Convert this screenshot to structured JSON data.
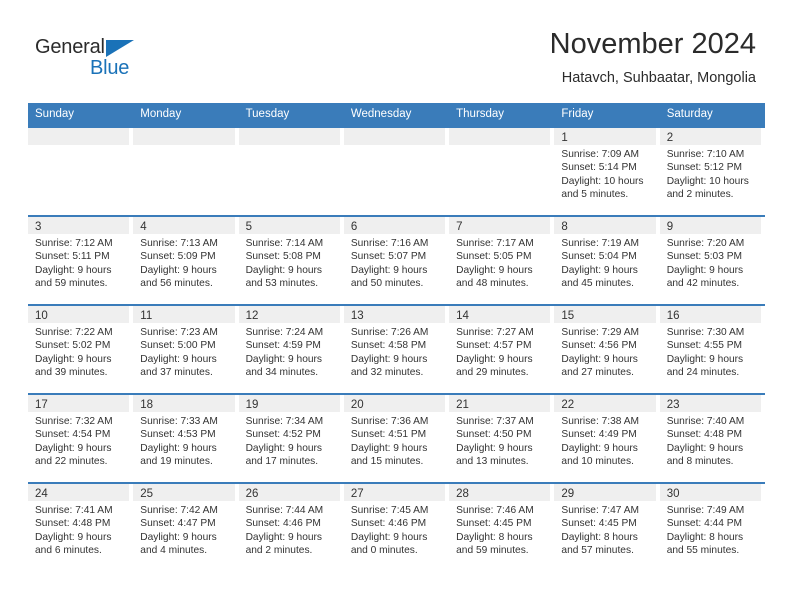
{
  "brand": {
    "name_part1": "General",
    "name_part2": "Blue",
    "flag_icon": "blue-triangle-flag",
    "accent_color": "#1a72b8"
  },
  "header": {
    "title": "November 2024",
    "subtitle": "Hatavch, Suhbaatar, Mongolia"
  },
  "theme": {
    "header_blue": "#3a7cba",
    "band_gray": "#efefef",
    "text": "#333333"
  },
  "weekdays": [
    "Sunday",
    "Monday",
    "Tuesday",
    "Wednesday",
    "Thursday",
    "Friday",
    "Saturday"
  ],
  "weeks": [
    [
      {
        "day": "",
        "lines": []
      },
      {
        "day": "",
        "lines": []
      },
      {
        "day": "",
        "lines": []
      },
      {
        "day": "",
        "lines": []
      },
      {
        "day": "",
        "lines": []
      },
      {
        "day": "1",
        "lines": [
          "Sunrise: 7:09 AM",
          "Sunset: 5:14 PM",
          "Daylight: 10 hours",
          "and 5 minutes."
        ]
      },
      {
        "day": "2",
        "lines": [
          "Sunrise: 7:10 AM",
          "Sunset: 5:12 PM",
          "Daylight: 10 hours",
          "and 2 minutes."
        ]
      }
    ],
    [
      {
        "day": "3",
        "lines": [
          "Sunrise: 7:12 AM",
          "Sunset: 5:11 PM",
          "Daylight: 9 hours",
          "and 59 minutes."
        ]
      },
      {
        "day": "4",
        "lines": [
          "Sunrise: 7:13 AM",
          "Sunset: 5:09 PM",
          "Daylight: 9 hours",
          "and 56 minutes."
        ]
      },
      {
        "day": "5",
        "lines": [
          "Sunrise: 7:14 AM",
          "Sunset: 5:08 PM",
          "Daylight: 9 hours",
          "and 53 minutes."
        ]
      },
      {
        "day": "6",
        "lines": [
          "Sunrise: 7:16 AM",
          "Sunset: 5:07 PM",
          "Daylight: 9 hours",
          "and 50 minutes."
        ]
      },
      {
        "day": "7",
        "lines": [
          "Sunrise: 7:17 AM",
          "Sunset: 5:05 PM",
          "Daylight: 9 hours",
          "and 48 minutes."
        ]
      },
      {
        "day": "8",
        "lines": [
          "Sunrise: 7:19 AM",
          "Sunset: 5:04 PM",
          "Daylight: 9 hours",
          "and 45 minutes."
        ]
      },
      {
        "day": "9",
        "lines": [
          "Sunrise: 7:20 AM",
          "Sunset: 5:03 PM",
          "Daylight: 9 hours",
          "and 42 minutes."
        ]
      }
    ],
    [
      {
        "day": "10",
        "lines": [
          "Sunrise: 7:22 AM",
          "Sunset: 5:02 PM",
          "Daylight: 9 hours",
          "and 39 minutes."
        ]
      },
      {
        "day": "11",
        "lines": [
          "Sunrise: 7:23 AM",
          "Sunset: 5:00 PM",
          "Daylight: 9 hours",
          "and 37 minutes."
        ]
      },
      {
        "day": "12",
        "lines": [
          "Sunrise: 7:24 AM",
          "Sunset: 4:59 PM",
          "Daylight: 9 hours",
          "and 34 minutes."
        ]
      },
      {
        "day": "13",
        "lines": [
          "Sunrise: 7:26 AM",
          "Sunset: 4:58 PM",
          "Daylight: 9 hours",
          "and 32 minutes."
        ]
      },
      {
        "day": "14",
        "lines": [
          "Sunrise: 7:27 AM",
          "Sunset: 4:57 PM",
          "Daylight: 9 hours",
          "and 29 minutes."
        ]
      },
      {
        "day": "15",
        "lines": [
          "Sunrise: 7:29 AM",
          "Sunset: 4:56 PM",
          "Daylight: 9 hours",
          "and 27 minutes."
        ]
      },
      {
        "day": "16",
        "lines": [
          "Sunrise: 7:30 AM",
          "Sunset: 4:55 PM",
          "Daylight: 9 hours",
          "and 24 minutes."
        ]
      }
    ],
    [
      {
        "day": "17",
        "lines": [
          "Sunrise: 7:32 AM",
          "Sunset: 4:54 PM",
          "Daylight: 9 hours",
          "and 22 minutes."
        ]
      },
      {
        "day": "18",
        "lines": [
          "Sunrise: 7:33 AM",
          "Sunset: 4:53 PM",
          "Daylight: 9 hours",
          "and 19 minutes."
        ]
      },
      {
        "day": "19",
        "lines": [
          "Sunrise: 7:34 AM",
          "Sunset: 4:52 PM",
          "Daylight: 9 hours",
          "and 17 minutes."
        ]
      },
      {
        "day": "20",
        "lines": [
          "Sunrise: 7:36 AM",
          "Sunset: 4:51 PM",
          "Daylight: 9 hours",
          "and 15 minutes."
        ]
      },
      {
        "day": "21",
        "lines": [
          "Sunrise: 7:37 AM",
          "Sunset: 4:50 PM",
          "Daylight: 9 hours",
          "and 13 minutes."
        ]
      },
      {
        "day": "22",
        "lines": [
          "Sunrise: 7:38 AM",
          "Sunset: 4:49 PM",
          "Daylight: 9 hours",
          "and 10 minutes."
        ]
      },
      {
        "day": "23",
        "lines": [
          "Sunrise: 7:40 AM",
          "Sunset: 4:48 PM",
          "Daylight: 9 hours",
          "and 8 minutes."
        ]
      }
    ],
    [
      {
        "day": "24",
        "lines": [
          "Sunrise: 7:41 AM",
          "Sunset: 4:48 PM",
          "Daylight: 9 hours",
          "and 6 minutes."
        ]
      },
      {
        "day": "25",
        "lines": [
          "Sunrise: 7:42 AM",
          "Sunset: 4:47 PM",
          "Daylight: 9 hours",
          "and 4 minutes."
        ]
      },
      {
        "day": "26",
        "lines": [
          "Sunrise: 7:44 AM",
          "Sunset: 4:46 PM",
          "Daylight: 9 hours",
          "and 2 minutes."
        ]
      },
      {
        "day": "27",
        "lines": [
          "Sunrise: 7:45 AM",
          "Sunset: 4:46 PM",
          "Daylight: 9 hours",
          "and 0 minutes."
        ]
      },
      {
        "day": "28",
        "lines": [
          "Sunrise: 7:46 AM",
          "Sunset: 4:45 PM",
          "Daylight: 8 hours",
          "and 59 minutes."
        ]
      },
      {
        "day": "29",
        "lines": [
          "Sunrise: 7:47 AM",
          "Sunset: 4:45 PM",
          "Daylight: 8 hours",
          "and 57 minutes."
        ]
      },
      {
        "day": "30",
        "lines": [
          "Sunrise: 7:49 AM",
          "Sunset: 4:44 PM",
          "Daylight: 8 hours",
          "and 55 minutes."
        ]
      }
    ]
  ]
}
